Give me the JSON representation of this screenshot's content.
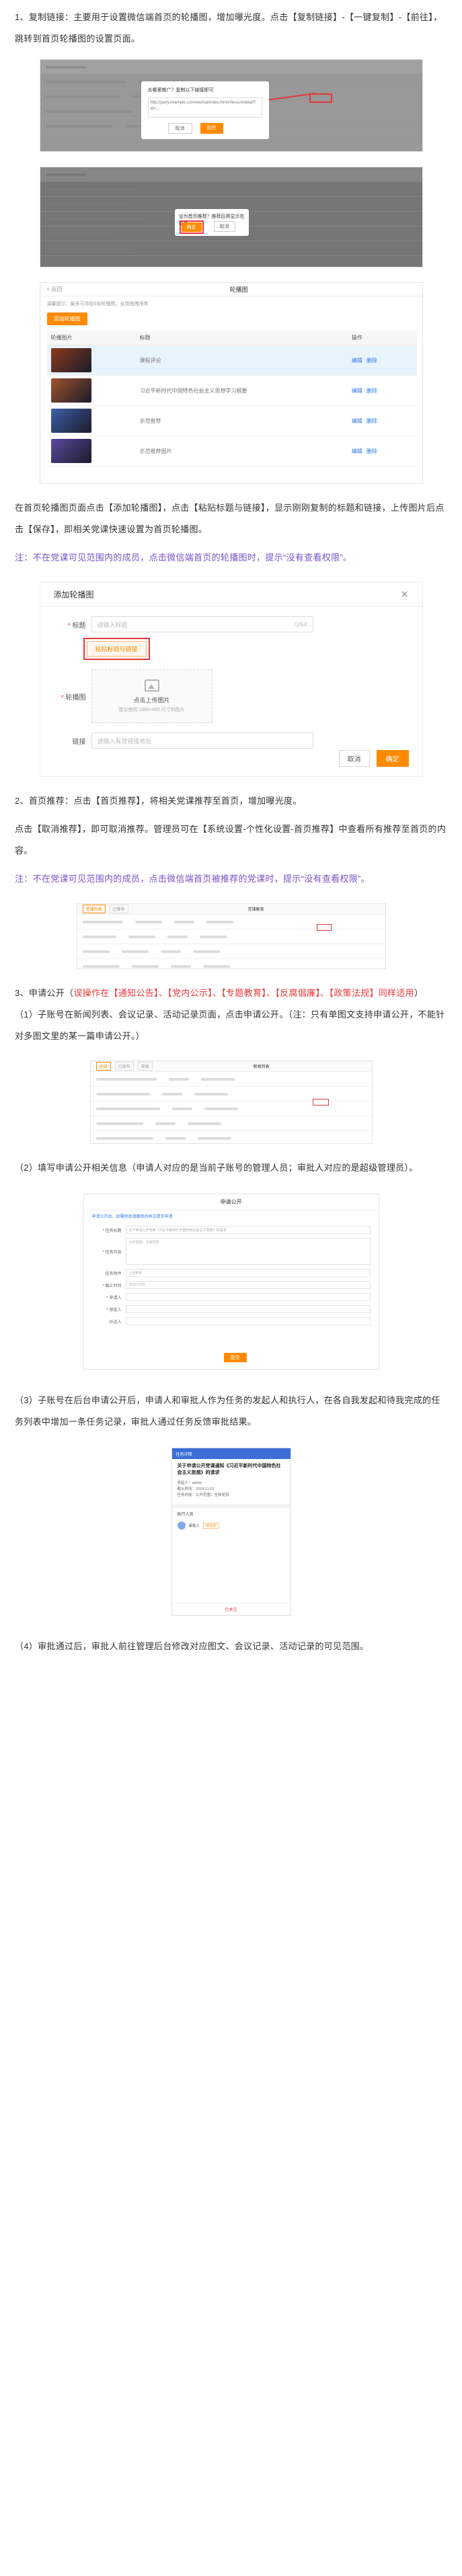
{
  "sections": {
    "s1_intro": "1、复制链接：主要用于设置微信端首页的轮播图，增加曝光度。点击【复制链接】-【一键复制】-【前往】，跳转到首页轮播图的设置页面。",
    "s1_step": "在首页轮播图页面点击【添加轮播图】，点击【粘贴标题与链接】，显示刚刚复制的标题和链接，上传图片后点击【保存】，即相关党课快速设置为首页轮播图。",
    "s1_note": "注：不在党课可见范围内的成员，点击微信端首页的轮播图时，提示“没有查看权限”。",
    "s2_intro": "2、首页推荐：点击【首页推荐】，将相关党课推荐至首页，增加曝光度。",
    "s2_cancel": "点击【取消推荐】，即可取消推荐。管理员可在【系统设置-个性化设置-首页推荐】中查看所有推荐至首页的内容。",
    "s2_note": "注：不在党课可见范围内的成员，点击微信端首页被推荐的党课时，提示“没有查看权限”。",
    "s3_intro_a": "3、申请公开（",
    "s3_intro_hl": "误操作在【通知公告】、【党内公示】、【专题教育】、【反腐倡廉】、【政策法规】同样适用",
    "s3_intro_b": "）",
    "s3_p1": "（1）子账号在新闻列表、会议记录、活动记录页面，点击申请公开。（注：只有单图文支持申请公开，不能针对多图文里的某一篇申请公开。）",
    "s3_p2": "（2）填写申请公开相关信息（申请人对应的是当前子账号的管理人员；审批人对应的是超级管理员）。",
    "s3_p3": "（3）子账号在后台申请公开后，申请人和审批人作为任务的发起人和执行人，在各自我发起和待我完成的任务列表中增加一条任务记录，审批人通过任务反馈审批结果。",
    "s3_p4": "（4）审批通过后，审批人前往管理后台修改对应图文、会议记录、活动记录的可见范围。"
  },
  "shot1": {
    "dialog_title": "去哪里推广？复制以下链接即可",
    "dialog_body": "http://party.example.com/wechat/index.html#/lesson/detail?id=...",
    "btn_cancel": "取消",
    "btn_go": "前往"
  },
  "shot2": {
    "dialog_title": "设为首页推荐？推荐后将显示在首页",
    "btn_ok": "确定",
    "btn_cancel": "取消"
  },
  "shot3": {
    "back": "< 返回",
    "title": "轮播图",
    "notice": "温馨提示：最多可添加5张轮播图，支持拖拽排序",
    "add_btn": "添加轮播图",
    "cols": [
      "轮播图片",
      "标题",
      "操作"
    ],
    "rows": [
      {
        "title": "课程评论",
        "ops": [
          "编辑",
          "删除"
        ],
        "color": "#8a3b1c"
      },
      {
        "title": "习近平新时代中国特色社会主义思想学习纲要",
        "ops": [
          "编辑",
          "删除"
        ],
        "color": "#a0522d"
      },
      {
        "title": "示范推荐",
        "ops": [
          "编辑",
          "删除"
        ],
        "color": "#3d5fa8"
      },
      {
        "title": "示范推荐图片",
        "ops": [
          "编辑",
          "删除"
        ],
        "color": "#5b4aa1"
      }
    ]
  },
  "shot4": {
    "title": "添加轮播图",
    "label_title": "标题",
    "placeholder_title": "请输入标题",
    "counter": "0/64",
    "paste_btn": "粘贴标题与链接",
    "label_image": "轮播图",
    "upload_text": "点击上传图片",
    "upload_hint": "建议使用 1080×460 尺寸的图片",
    "label_link": "链接",
    "placeholder_link": "请输入有效链接地址",
    "cancel": "取消",
    "ok": "确定"
  },
  "shot5": {
    "title": "党课教育",
    "tabs": [
      "党课列表",
      "已推荐"
    ]
  },
  "shot6": {
    "title": "新闻列表",
    "tabs": [
      "全部",
      "已发布",
      "草稿"
    ]
  },
  "shot7": {
    "title": "申请公开",
    "tip": "申请公开后，如需修改请撤回后再次提交申请",
    "fields": [
      {
        "label": "* 任务标题",
        "value": "关于申请公开党课《习近平新时代中国特色社会主义思想》的请求"
      },
      {
        "label": "* 任务内容",
        "value": "公开范围：全体党员",
        "tall": true
      },
      {
        "label": "任务附件",
        "value": "上传附件"
      },
      {
        "label": "* 截止时间",
        "value": "2019-11-01"
      },
      {
        "label": "* 申请人",
        "value": ""
      },
      {
        "label": "* 审批人",
        "value": ""
      },
      {
        "label": "抄送人",
        "value": ""
      }
    ],
    "submit": "提交"
  },
  "shot8": {
    "header": "任务详情",
    "task_title": "关于申请公开党课通知《习近平新时代中国特色社会主义思想》的请求",
    "meta_lines": [
      "发起人：admin",
      "截止时间：2019-11-01",
      "任务内容：公开范围：全体党员"
    ],
    "section": "执行人员",
    "person": "审批人",
    "tag": "待完成",
    "bottom": "已关注"
  },
  "colors": {
    "accent": "#ff8a00",
    "note": "#7a52c7",
    "highlight": "#e5383b",
    "link": "#2d7be5"
  }
}
